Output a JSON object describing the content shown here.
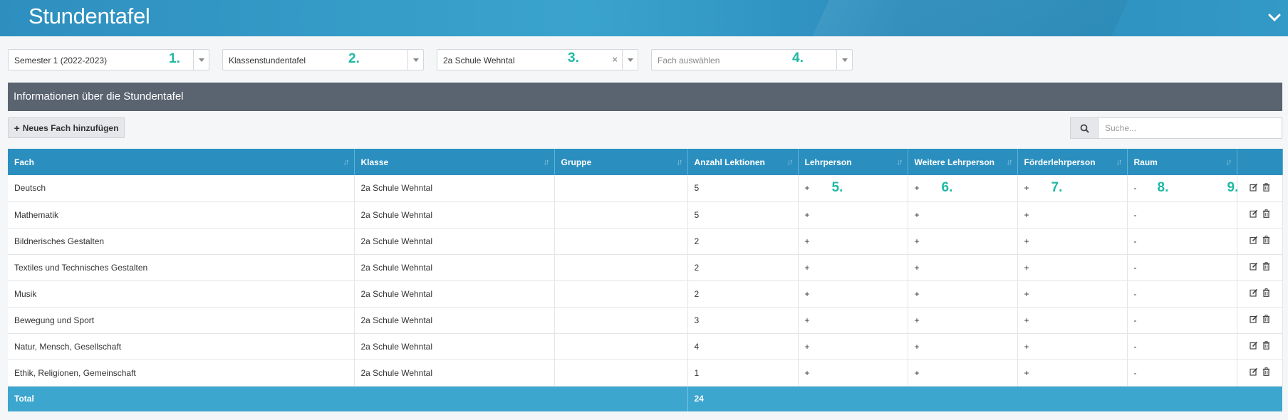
{
  "header": {
    "title": "Stundentafel"
  },
  "filters": {
    "semester": {
      "value": "Semester 1 (2022-2023)",
      "step": "1."
    },
    "type": {
      "value": "Klassenstundentafel",
      "step": "2."
    },
    "klasse": {
      "value": "2a Schule Wehntal",
      "step": "3.",
      "clear": "×"
    },
    "fach": {
      "placeholder": "Fach auswählen",
      "step": "4."
    }
  },
  "section": {
    "title": "Informationen über die Stundentafel"
  },
  "toolbar": {
    "add_label": "Neues Fach hinzufügen",
    "search_placeholder": "Suche..."
  },
  "table": {
    "columns": [
      "Fach",
      "Klasse",
      "Gruppe",
      "Anzahl Lektionen",
      "Lehrperson",
      "Weitere Lehrperson",
      "Förderlehrperson",
      "Raum"
    ],
    "rows": [
      [
        "Deutsch",
        "2a Schule Wehntal",
        "",
        "5",
        "+",
        "+",
        "+",
        "-"
      ],
      [
        "Mathematik",
        "2a Schule Wehntal",
        "",
        "5",
        "+",
        "+",
        "+",
        "-"
      ],
      [
        "Bildnerisches Gestalten",
        "2a Schule Wehntal",
        "",
        "2",
        "+",
        "+",
        "+",
        "-"
      ],
      [
        "Textiles und Technisches Gestalten",
        "2a Schule Wehntal",
        "",
        "2",
        "+",
        "+",
        "+",
        "-"
      ],
      [
        "Musik",
        "2a Schule Wehntal",
        "",
        "2",
        "+",
        "+",
        "+",
        "-"
      ],
      [
        "Bewegung und Sport",
        "2a Schule Wehntal",
        "",
        "3",
        "+",
        "+",
        "+",
        "-"
      ],
      [
        "Natur, Mensch, Gesellschaft",
        "2a Schule Wehntal",
        "",
        "4",
        "+",
        "+",
        "+",
        "-"
      ],
      [
        "Ethik, Religionen, Gemeinschaft",
        "2a Schule Wehntal",
        "",
        "1",
        "+",
        "+",
        "+",
        "-"
      ]
    ],
    "total_label": "Total",
    "total_value": "24"
  },
  "steps_row": {
    "lehrperson": "5.",
    "weitere": "6.",
    "foerder": "7.",
    "raum": "8.",
    "actions": "9."
  },
  "colors": {
    "accent": "#2a8fbf",
    "step": "#1fb9a4",
    "section": "#5a6370",
    "total": "#3ca6cf"
  }
}
